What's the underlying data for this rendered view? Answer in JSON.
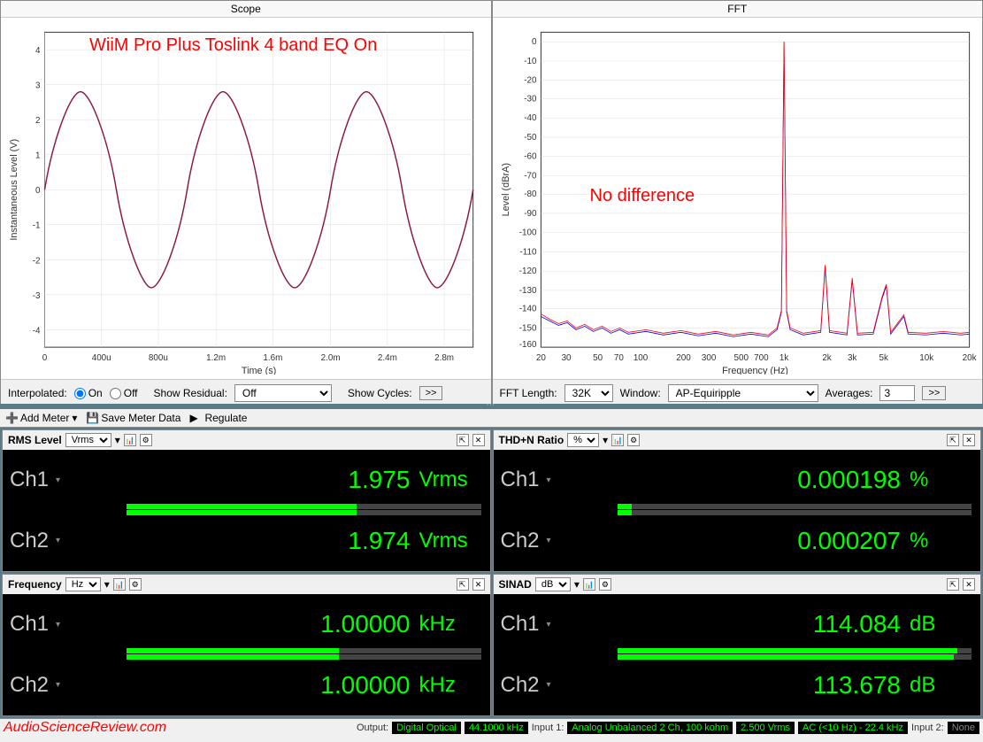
{
  "scope": {
    "title": "Scope",
    "annotation": "WiiM Pro Plus Toslink 4 band EQ On",
    "xlabel": "Time (s)",
    "ylabel": "Instantaneous Level (V)",
    "controls": {
      "interpolated_label": "Interpolated:",
      "on_label": "On",
      "off_label": "Off",
      "show_residual_label": "Show Residual:",
      "show_residual_value": "Off",
      "show_cycles_label": "Show Cycles:",
      "more": ">>"
    }
  },
  "fft": {
    "title": "FFT",
    "annotation": "No difference",
    "xlabel": "Frequency (Hz)",
    "ylabel": "Level (dBrA)",
    "controls": {
      "fft_length_label": "FFT Length:",
      "fft_length_value": "32K",
      "window_label": "Window:",
      "window_value": "AP-Equiripple",
      "averages_label": "Averages:",
      "averages_value": "3",
      "more": ">>"
    }
  },
  "toolbar": {
    "add_meter": "Add Meter",
    "save_meter": "Save Meter Data",
    "regulate": "Regulate"
  },
  "meters": {
    "rms": {
      "title": "RMS Level",
      "unit_sel": "Vrms",
      "ch1_label": "Ch1",
      "ch1_value": "1.975",
      "ch1_unit": "Vrms",
      "ch2_label": "Ch2",
      "ch2_value": "1.974",
      "ch2_unit": "Vrms",
      "bar1": 65,
      "bar2": 65
    },
    "thdn": {
      "title": "THD+N Ratio",
      "unit_sel": "%",
      "ch1_label": "Ch1",
      "ch1_value": "0.000198",
      "ch1_unit": "%",
      "ch2_label": "Ch2",
      "ch2_value": "0.000207",
      "ch2_unit": "%",
      "bar1": 4,
      "bar2": 4
    },
    "freq": {
      "title": "Frequency",
      "unit_sel": "Hz",
      "ch1_label": "Ch1",
      "ch1_value": "1.00000",
      "ch1_unit": "kHz",
      "ch2_label": "Ch2",
      "ch2_value": "1.00000",
      "ch2_unit": "kHz",
      "bar1": 60,
      "bar2": 60
    },
    "sinad": {
      "title": "SINAD",
      "unit_sel": "dB",
      "ch1_label": "Ch1",
      "ch1_value": "114.084",
      "ch1_unit": "dB",
      "ch2_label": "Ch2",
      "ch2_value": "113.678",
      "ch2_unit": "dB",
      "bar1": 96,
      "bar2": 95
    }
  },
  "status": {
    "watermark": "AudioScienceReview.com",
    "output_label": "Output:",
    "output1": "Digital Optical",
    "output2": "44.1000 kHz",
    "input1_label": "Input 1:",
    "input1a": "Analog Unbalanced 2 Ch, 100 kohm",
    "input1b": "2.500 Vrms",
    "input1c": "AC (<10 Hz) - 22.4 kHz",
    "input2_label": "Input 2:",
    "input2": "None"
  },
  "chart_data": [
    {
      "type": "line",
      "title": "Scope",
      "xlabel": "Time (s)",
      "ylabel": "Instantaneous Level (V)",
      "xlim": [
        0,
        0.003
      ],
      "ylim": [
        -4.5,
        4.5
      ],
      "xticks": [
        0,
        0.0004,
        0.0008,
        0.0012,
        0.0016,
        0.002,
        0.0024,
        0.0028
      ],
      "xtick_labels": [
        "0",
        "400u",
        "800u",
        "1.2m",
        "1.6m",
        "2.0m",
        "2.4m",
        "2.8m"
      ],
      "yticks": [
        -4,
        -3,
        -2,
        -1,
        0,
        1,
        2,
        3,
        4
      ],
      "series": [
        {
          "name": "waveform",
          "description": "1 kHz sine wave, amplitude ≈ 2.8 V peak, 3 full cycles shown"
        }
      ],
      "annotation": "WiiM Pro Plus Toslink 4 band EQ On"
    },
    {
      "type": "line",
      "title": "FFT",
      "xlabel": "Frequency (Hz)",
      "ylabel": "Level (dBrA)",
      "xscale": "log",
      "xlim": [
        20,
        20000
      ],
      "ylim": [
        -160,
        5
      ],
      "xticks": [
        20,
        30,
        50,
        70,
        100,
        200,
        300,
        500,
        700,
        1000,
        2000,
        3000,
        5000,
        10000,
        20000
      ],
      "xtick_labels": [
        "20",
        "30",
        "50",
        "70",
        "100",
        "200",
        "300",
        "500",
        "700",
        "1k",
        "2k",
        "3k",
        "5k",
        "10k",
        "20k"
      ],
      "yticks": [
        0,
        -10,
        -20,
        -30,
        -40,
        -50,
        -60,
        -70,
        -80,
        -90,
        -100,
        -110,
        -120,
        -130,
        -140,
        -150,
        -160
      ],
      "series": [
        {
          "name": "Ch1 (red)",
          "noise_floor_db": -152,
          "fundamental_hz": 1000,
          "fundamental_db": 0,
          "harmonics_db": {
            "2000": -118,
            "3000": -125,
            "4000": -135,
            "5000": -128,
            "7000": -148
          }
        },
        {
          "name": "Ch2 (blue)",
          "noise_floor_db": -152,
          "fundamental_hz": 1000,
          "fundamental_db": 0,
          "harmonics_db": {
            "2000": -118,
            "3000": -125,
            "4000": -135,
            "5000": -128,
            "7000": -148
          }
        }
      ],
      "annotation": "No difference"
    }
  ]
}
